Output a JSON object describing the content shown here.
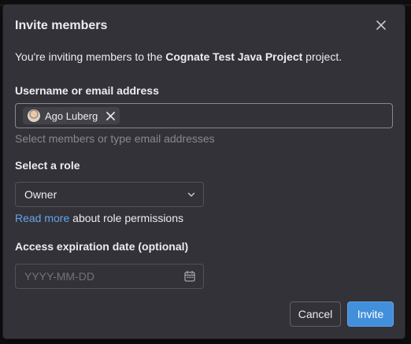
{
  "modal": {
    "title": "Invite members",
    "intro_prefix": "You're inviting members to the ",
    "project_name": "Cognate Test Java Project",
    "intro_suffix": " project."
  },
  "members_field": {
    "label": "Username or email address",
    "selected_members": [
      {
        "name": "Ago Luberg",
        "icon": "avatar"
      }
    ],
    "hint": "Select members or type email addresses"
  },
  "role_field": {
    "label": "Select a role",
    "selected_value": "Owner",
    "link_text": "Read more",
    "link_suffix": " about role permissions"
  },
  "expiration_field": {
    "label": "Access expiration date (optional)",
    "placeholder": "YYYY-MM-DD",
    "icon": "calendar-icon"
  },
  "actions": {
    "cancel_label": "Cancel",
    "invite_label": "Invite"
  },
  "colors": {
    "accent": "#428fdc",
    "link": "#63a6e9",
    "modal_bg": "#333238",
    "text": "#ececef",
    "muted_text": "#89888d"
  }
}
